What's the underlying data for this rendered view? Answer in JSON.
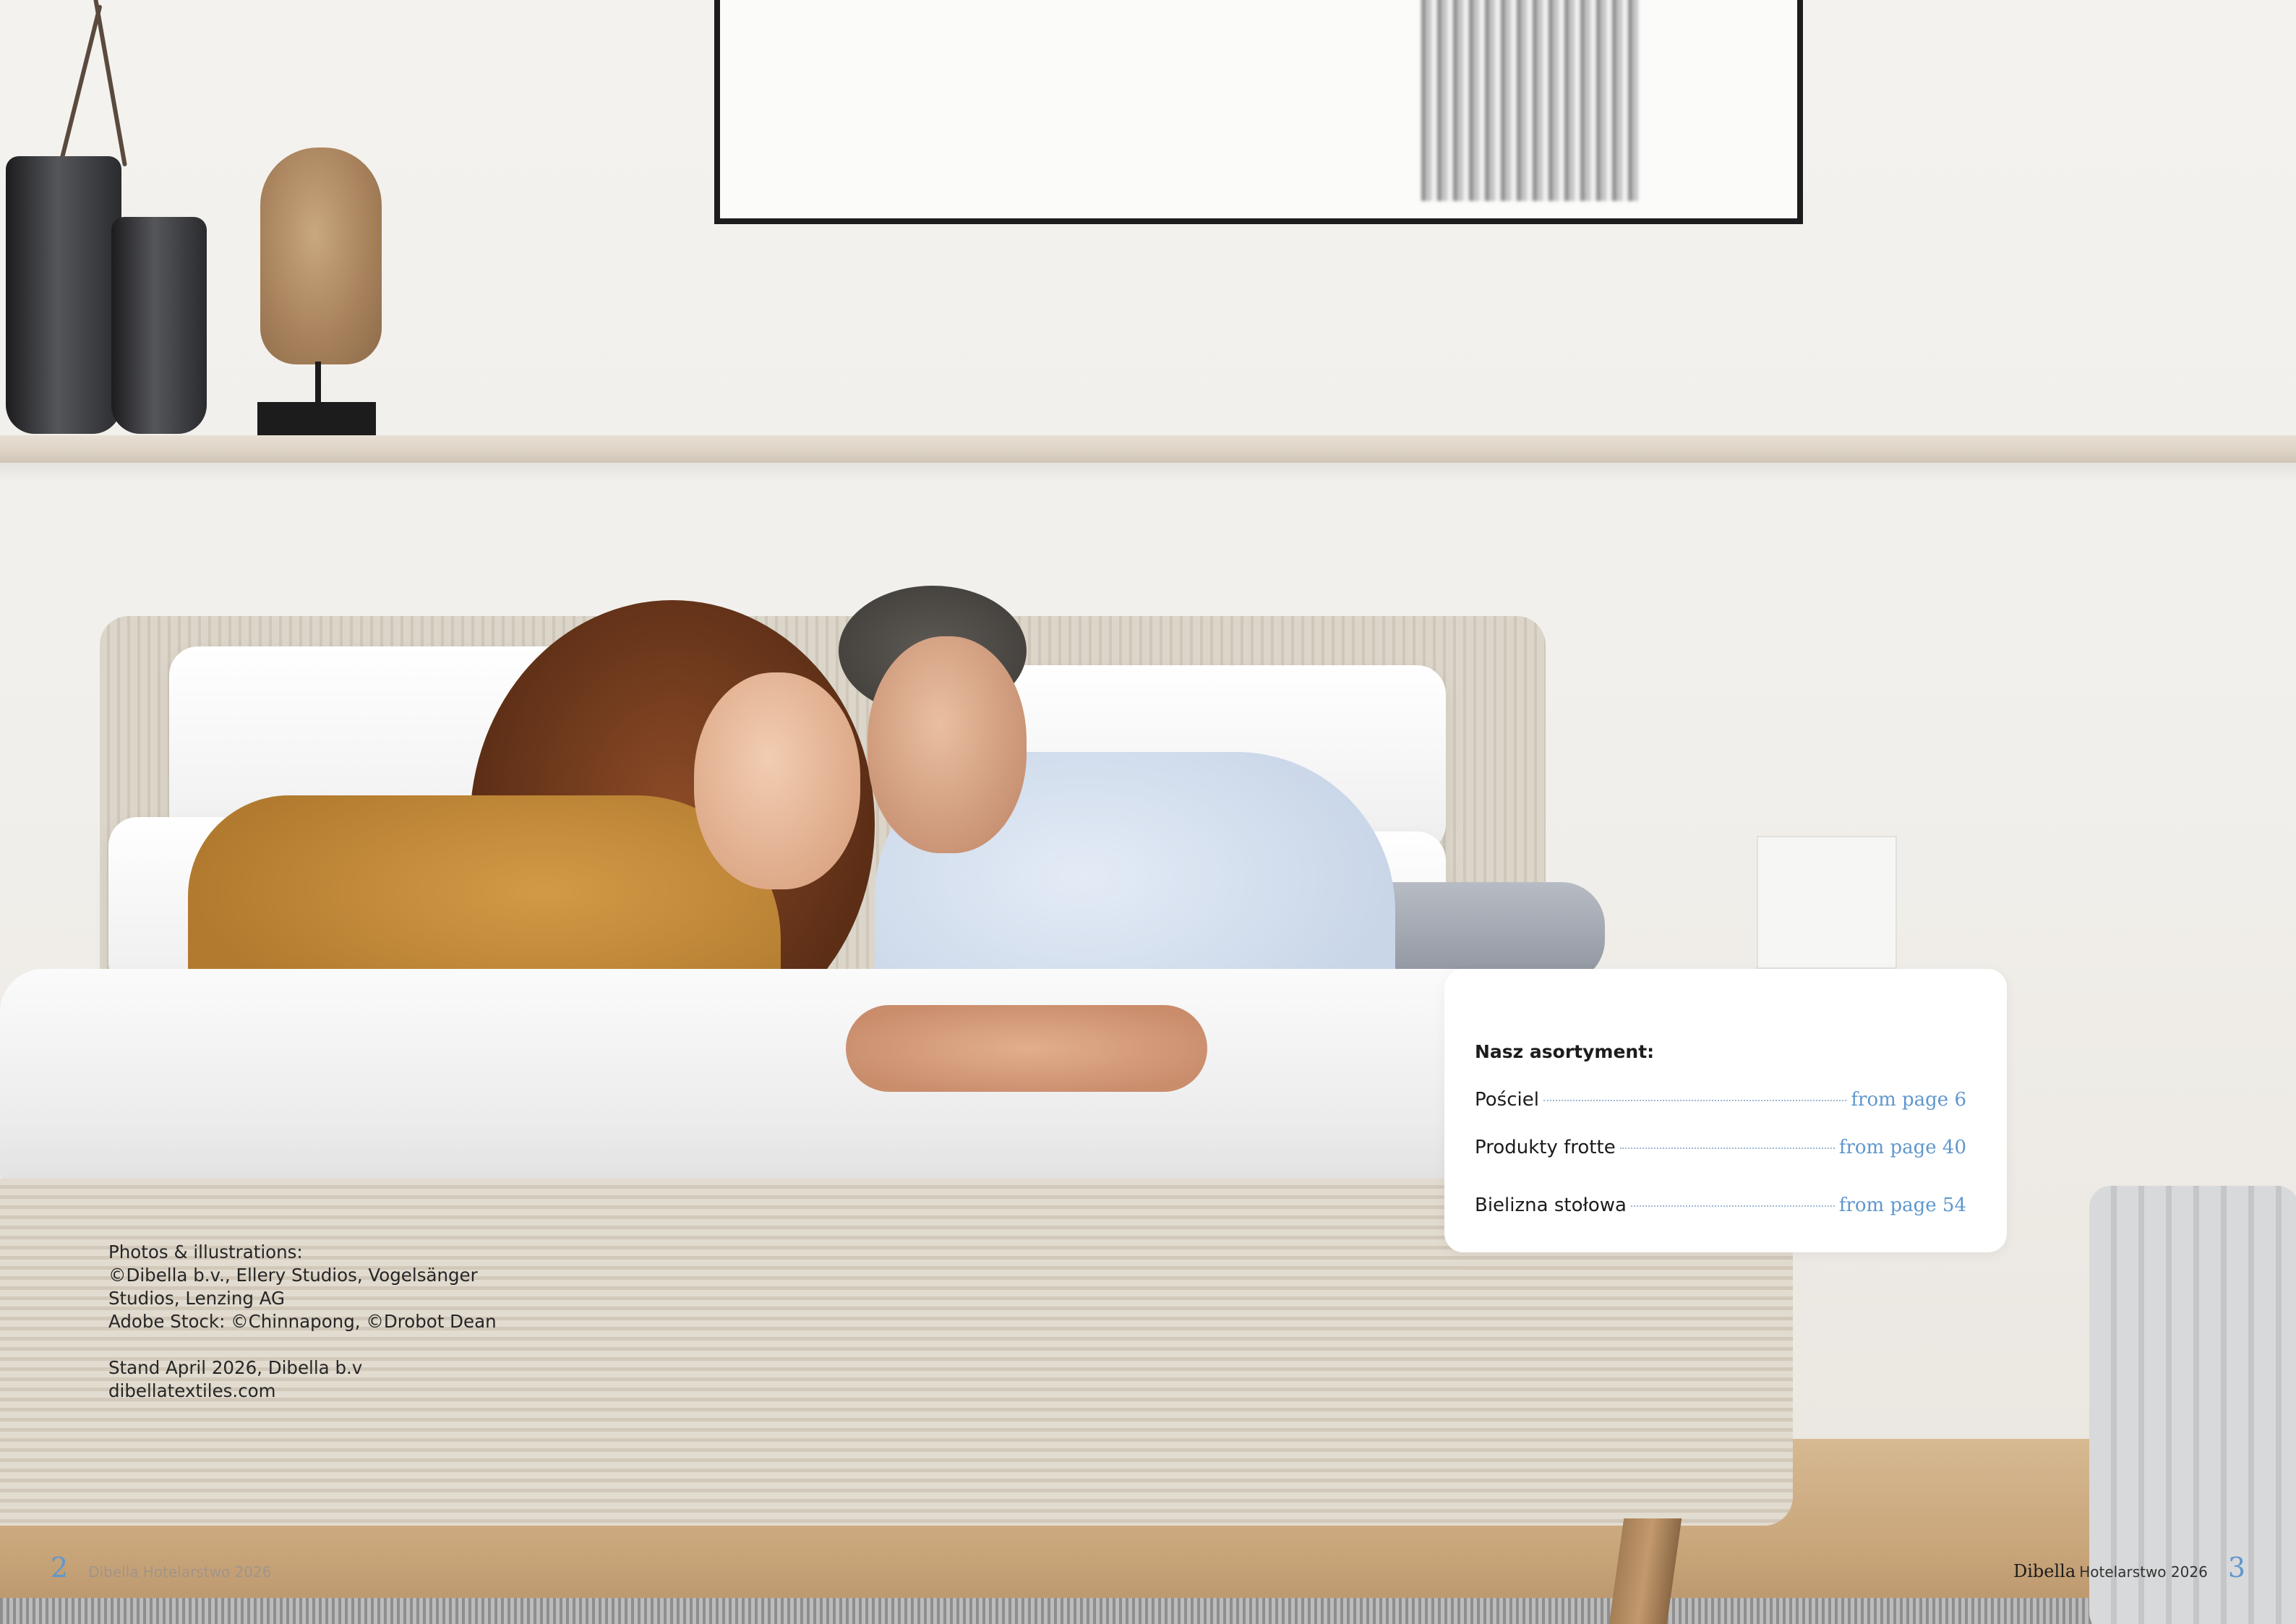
{
  "credits": {
    "line1": "Photos & illustrations:",
    "line2": "©Dibella b.v., Ellery Studios, Vogelsänger",
    "line3": "Studios, Lenzing AG",
    "line4": "Adobe Stock: ©Chinnapong, ©Drobot Dean",
    "line5": "Stand April 2026, Dibella b.v",
    "line6": "dibellatextiles.com"
  },
  "toc": {
    "title": "Nasz asortyment:",
    "items": [
      {
        "label": "Pościel",
        "page": "from page 6"
      },
      {
        "label": "Produkty frotte",
        "page": "from page 40"
      },
      {
        "label": "Bielizna stołowa",
        "page": "from page 54"
      }
    ]
  },
  "footer": {
    "left_page": "2",
    "left_text": "Dibella Hotelarstwo 2026",
    "right_brand": "Dibella",
    "right_text": "Hotelarstwo 2026",
    "right_page": "3"
  },
  "colors": {
    "accent": "#5f97cd",
    "text": "#1c1c1c",
    "card": "#ffffff"
  }
}
